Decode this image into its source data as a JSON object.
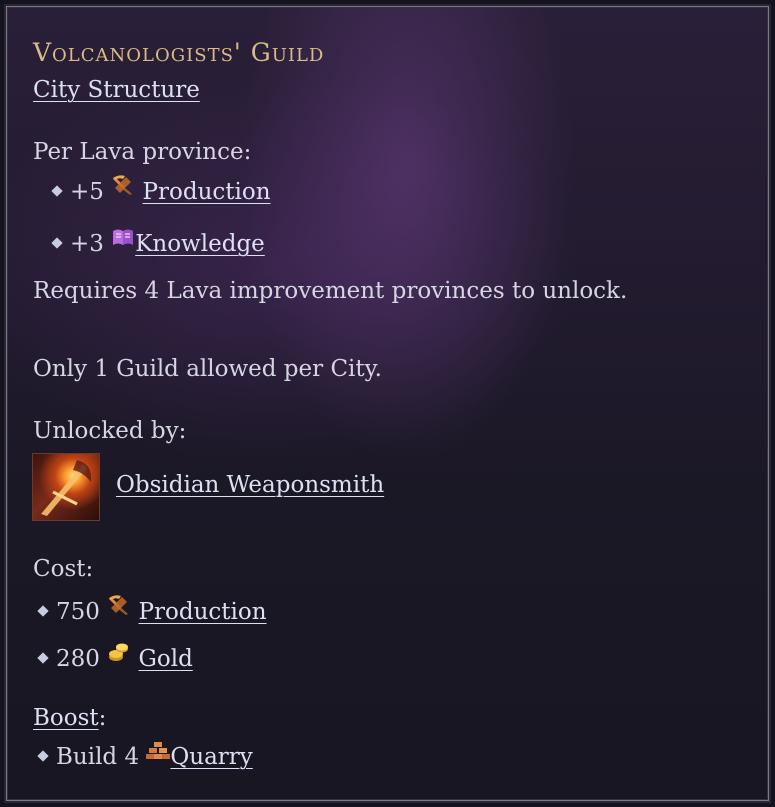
{
  "tooltip": {
    "title": "Volcanologists' Guild",
    "category": "City Structure",
    "per_province_header": "Per Lava province:",
    "per_province_items": [
      {
        "amount": "+5",
        "icon": "production-icon",
        "label": "Production"
      },
      {
        "amount": "+3",
        "icon": "knowledge-icon",
        "label": "Knowledge"
      }
    ],
    "requirement": "Requires 4 Lava improvement provinces to unlock.",
    "restriction": "Only 1 Guild allowed per City.",
    "unlocked_by_header": "Unlocked by:",
    "unlocked_by": {
      "icon": "obsidian-weaponsmith-icon",
      "label": "Obsidian Weaponsmith"
    },
    "cost_header": "Cost:",
    "cost_items": [
      {
        "amount": "750",
        "icon": "production-icon",
        "label": "Production"
      },
      {
        "amount": "280",
        "icon": "gold-icon",
        "label": "Gold"
      }
    ],
    "boost_label": "Boost",
    "boost_colon": ":",
    "boost_items": [
      {
        "prefix": "Build 4",
        "icon": "quarry-icon",
        "label": "Quarry"
      }
    ]
  },
  "colors": {
    "title": "#d8bb85",
    "text": "#d5d6e2",
    "link": "#dde0f3",
    "background": "#1b1826"
  }
}
